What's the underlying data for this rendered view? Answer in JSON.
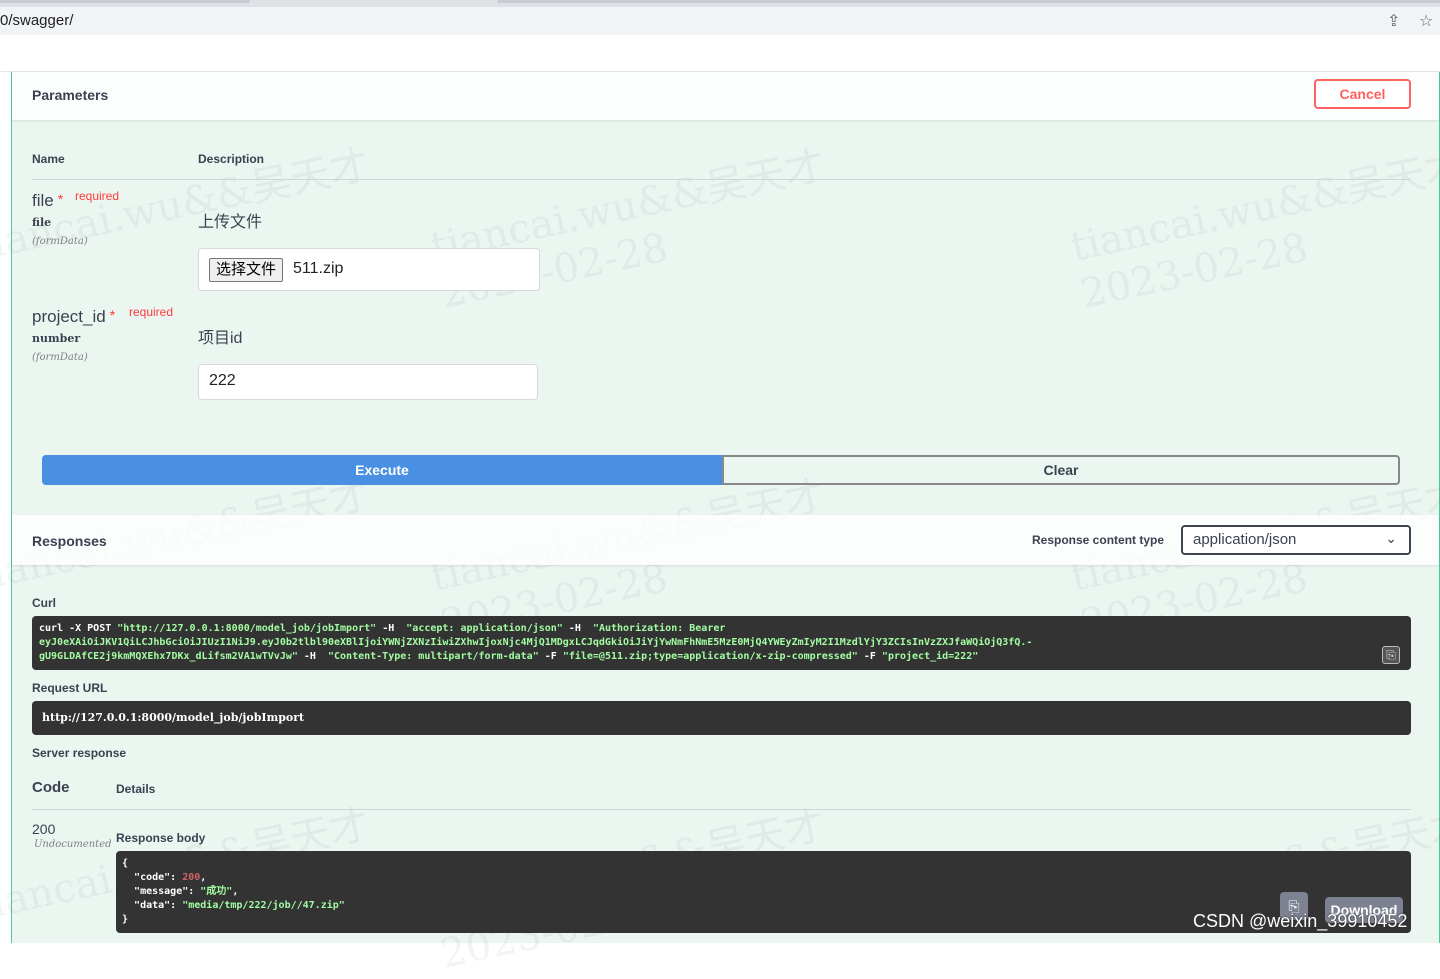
{
  "browser": {
    "url": "0/swagger/",
    "share_icon": "share-icon",
    "star_icon": "star-icon"
  },
  "parameters": {
    "title": "Parameters",
    "cancel_label": "Cancel",
    "col_name": "Name",
    "col_description": "Description",
    "items": [
      {
        "name": "file",
        "required_mark": "*",
        "required_label": "required",
        "type": "file",
        "in": "(formData)",
        "description": "上传文件",
        "file_button": "选择文件",
        "file_value": "511.zip"
      },
      {
        "name": "project_id",
        "required_mark": "*",
        "required_label": "required",
        "type": "number",
        "in": "(formData)",
        "description": "项目id",
        "value": "222"
      }
    ],
    "execute_label": "Execute",
    "clear_label": "Clear"
  },
  "responses": {
    "title": "Responses",
    "content_type_label": "Response content type",
    "content_type_value": "application/json",
    "curl_label": "Curl",
    "curl_line1_a": "curl -X POST ",
    "curl_line1_b": "\"http://127.0.0.1:8000/model_job/jobImport\"",
    "curl_line1_c": " -H  ",
    "curl_line1_d": "\"accept: application/json\"",
    "curl_line1_e": " -H  ",
    "curl_line1_f": "\"Authorization: Bearer",
    "curl_line2": "eyJ0eXAiOiJKV1QiLCJhbGciOiJIUzI1NiJ9.eyJ0b2tlbl90eXBlIjoiYWNjZXNzIiwiZXhwIjoxNjc4MjQ1MDgxLCJqdGkiOiJiYjYwNmFhNmE5MzE0MjQ4YWEyZmIyM2I1MzdlYjY3ZCIsInVzZXJfaWQiOjQ3fQ.-",
    "curl_line3_a": "gU9GLDAfCE2j9kmMQXEhx7DKx_dLifsm2VA1wTVvJw\"",
    "curl_line3_b": " -H  ",
    "curl_line3_c": "\"Content-Type: multipart/form-data\"",
    "curl_line3_d": " -F ",
    "curl_line3_e": "\"file=@511.zip;type=application/x-zip-compressed\"",
    "curl_line3_f": " -F ",
    "curl_line3_g": "\"project_id=222\"",
    "request_url_label": "Request URL",
    "request_url": "http://127.0.0.1:8000/model_job/jobImport",
    "server_response_label": "Server response",
    "code_header": "Code",
    "details_header": "Details",
    "code": "200",
    "undocumented": "Undocumented",
    "response_body_label": "Response body",
    "body": {
      "open": "{",
      "code_key": "\"code\"",
      "code_val": "200",
      "message_key": "\"message\"",
      "message_val": "\"成功\"",
      "data_key": "\"data\"",
      "data_val": "\"media/tmp/222/job//47.zip\"",
      "close": "}"
    },
    "download_label": "Download"
  },
  "watermark": {
    "line1": "tiancai.wu&&吴天才",
    "line2": "2023-02-28"
  },
  "csdn_credit": "CSDN @weixin_39910452",
  "colors": {
    "accent_post": "#49cc90",
    "execute": "#4990e2",
    "cancel": "#ff6060",
    "code_bg": "#333333"
  }
}
